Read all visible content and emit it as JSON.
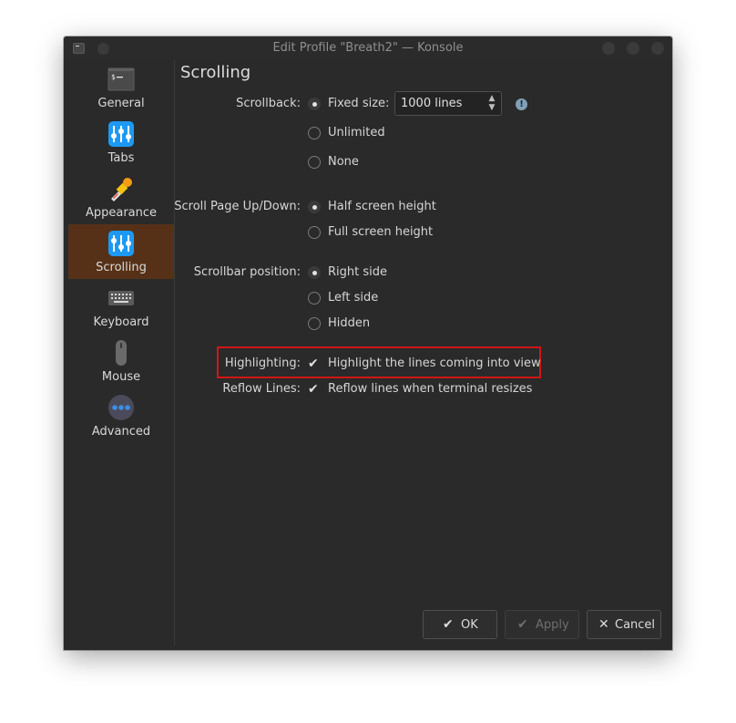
{
  "window": {
    "title": "Edit Profile \"Breath2\" — Konsole"
  },
  "sidebar": {
    "items": [
      {
        "label": "General",
        "icon": "terminal-icon"
      },
      {
        "label": "Tabs",
        "icon": "tabs-icon"
      },
      {
        "label": "Appearance",
        "icon": "color-picker-icon"
      },
      {
        "label": "Scrolling",
        "icon": "scrolling-icon",
        "selected": true
      },
      {
        "label": "Keyboard",
        "icon": "keyboard-icon"
      },
      {
        "label": "Mouse",
        "icon": "mouse-icon"
      },
      {
        "label": "Advanced",
        "icon": "more-icon"
      }
    ]
  },
  "page": {
    "title": "Scrolling"
  },
  "scrollback": {
    "label": "Scrollback:",
    "fixed_size": "Fixed size:",
    "size_value": "1000 lines",
    "unlimited": "Unlimited",
    "none": "None",
    "info_glyph": "!"
  },
  "scroll_page": {
    "label": "Scroll Page Up/Down:",
    "half": "Half screen height",
    "full": "Full screen height"
  },
  "scrollbar": {
    "label": "Scrollbar position:",
    "right": "Right side",
    "left": "Left side",
    "hidden": "Hidden"
  },
  "highlighting": {
    "label": "Highlighting:",
    "option": "Highlight the lines coming into view",
    "checked": true
  },
  "reflow": {
    "label": "Reflow Lines:",
    "option": "Reflow lines when terminal resizes",
    "checked": true
  },
  "buttons": {
    "ok": "OK",
    "apply": "Apply",
    "cancel": "Cancel"
  },
  "colors": {
    "window_bg": "#2a2a2a",
    "selected_bg": "#573117",
    "accent_blue": "#1d99f3",
    "highlight_box": "#d11616"
  }
}
